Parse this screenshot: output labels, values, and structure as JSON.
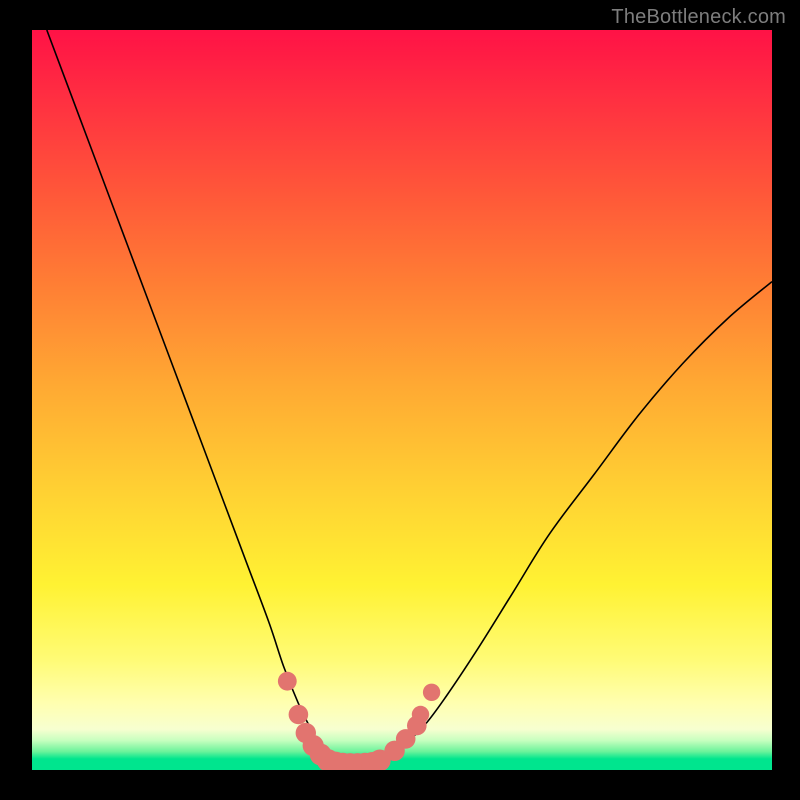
{
  "watermark": "TheBottleneck.com",
  "chart_data": {
    "type": "line",
    "title": "",
    "xlabel": "",
    "ylabel": "",
    "xlim": [
      0,
      100
    ],
    "ylim": [
      0,
      100
    ],
    "series": [
      {
        "name": "bottleneck-curve",
        "x": [
          2,
          5,
          8,
          11,
          14,
          17,
          20,
          23,
          26,
          29,
          32,
          34,
          36,
          38,
          40,
          41,
          42,
          43,
          44,
          45,
          46,
          48,
          50,
          53,
          56,
          60,
          65,
          70,
          76,
          82,
          88,
          94,
          100
        ],
        "values": [
          100,
          92,
          84,
          76,
          68,
          60,
          52,
          44,
          36,
          28,
          20,
          14,
          9,
          5,
          2,
          1.2,
          0.8,
          0.7,
          0.7,
          0.8,
          1.0,
          1.8,
          3.2,
          6.0,
          10,
          16,
          24,
          32,
          40,
          48,
          55,
          61,
          66
        ]
      }
    ],
    "markers": {
      "name": "highlighted-points",
      "color": "#e2746f",
      "points": [
        {
          "x": 34.5,
          "y": 12.0,
          "r": 1.2
        },
        {
          "x": 36.0,
          "y": 7.5,
          "r": 1.3
        },
        {
          "x": 37.0,
          "y": 5.0,
          "r": 1.4
        },
        {
          "x": 38.0,
          "y": 3.3,
          "r": 1.5
        },
        {
          "x": 39.0,
          "y": 2.1,
          "r": 1.6
        },
        {
          "x": 40.0,
          "y": 1.3,
          "r": 1.7
        },
        {
          "x": 41.0,
          "y": 0.9,
          "r": 1.8
        },
        {
          "x": 42.0,
          "y": 0.75,
          "r": 1.8
        },
        {
          "x": 43.0,
          "y": 0.7,
          "r": 1.8
        },
        {
          "x": 44.0,
          "y": 0.7,
          "r": 1.8
        },
        {
          "x": 45.0,
          "y": 0.75,
          "r": 1.8
        },
        {
          "x": 46.0,
          "y": 0.9,
          "r": 1.7
        },
        {
          "x": 47.0,
          "y": 1.3,
          "r": 1.6
        },
        {
          "x": 49.0,
          "y": 2.6,
          "r": 1.4
        },
        {
          "x": 50.5,
          "y": 4.2,
          "r": 1.3
        },
        {
          "x": 52.0,
          "y": 6.0,
          "r": 1.3
        },
        {
          "x": 52.5,
          "y": 7.5,
          "r": 1.0
        },
        {
          "x": 54.0,
          "y": 10.5,
          "r": 1.0
        }
      ]
    },
    "gradient_bands": [
      {
        "color": "#ff1246",
        "stop": 0
      },
      {
        "color": "#ff8034",
        "stop": 35
      },
      {
        "color": "#fff233",
        "stop": 75
      },
      {
        "color": "#ffffb0",
        "stop": 91
      },
      {
        "color": "#00e58e",
        "stop": 99
      }
    ]
  }
}
